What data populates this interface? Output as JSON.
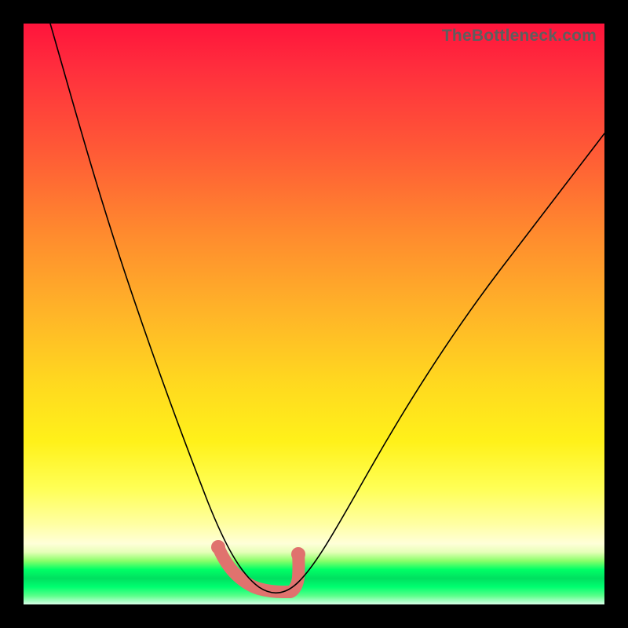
{
  "watermark": "TheBottleneck.com",
  "colors": {
    "background": "#000000",
    "gradient_top": "#ff143c",
    "gradient_mid": "#ffd91f",
    "gradient_green": "#00ff66",
    "curve": "#000000",
    "highlight": "#e0726e"
  },
  "chart_data": {
    "type": "line",
    "title": "",
    "xlabel": "",
    "ylabel": "",
    "xlim": [
      0,
      1
    ],
    "ylim": [
      0,
      1
    ],
    "x": [
      0.0,
      0.05,
      0.1,
      0.15,
      0.2,
      0.25,
      0.3,
      0.34,
      0.38,
      0.42,
      0.47,
      0.55,
      0.62,
      0.7,
      0.78,
      0.86,
      0.94,
      1.0
    ],
    "series": [
      {
        "name": "bottleneck-curve",
        "values": [
          1.0,
          0.88,
          0.74,
          0.6,
          0.46,
          0.33,
          0.2,
          0.1,
          0.04,
          0.02,
          0.02,
          0.08,
          0.17,
          0.28,
          0.4,
          0.52,
          0.63,
          0.71
        ]
      }
    ],
    "highlight_range_x": [
      0.34,
      0.47
    ],
    "annotations": []
  }
}
